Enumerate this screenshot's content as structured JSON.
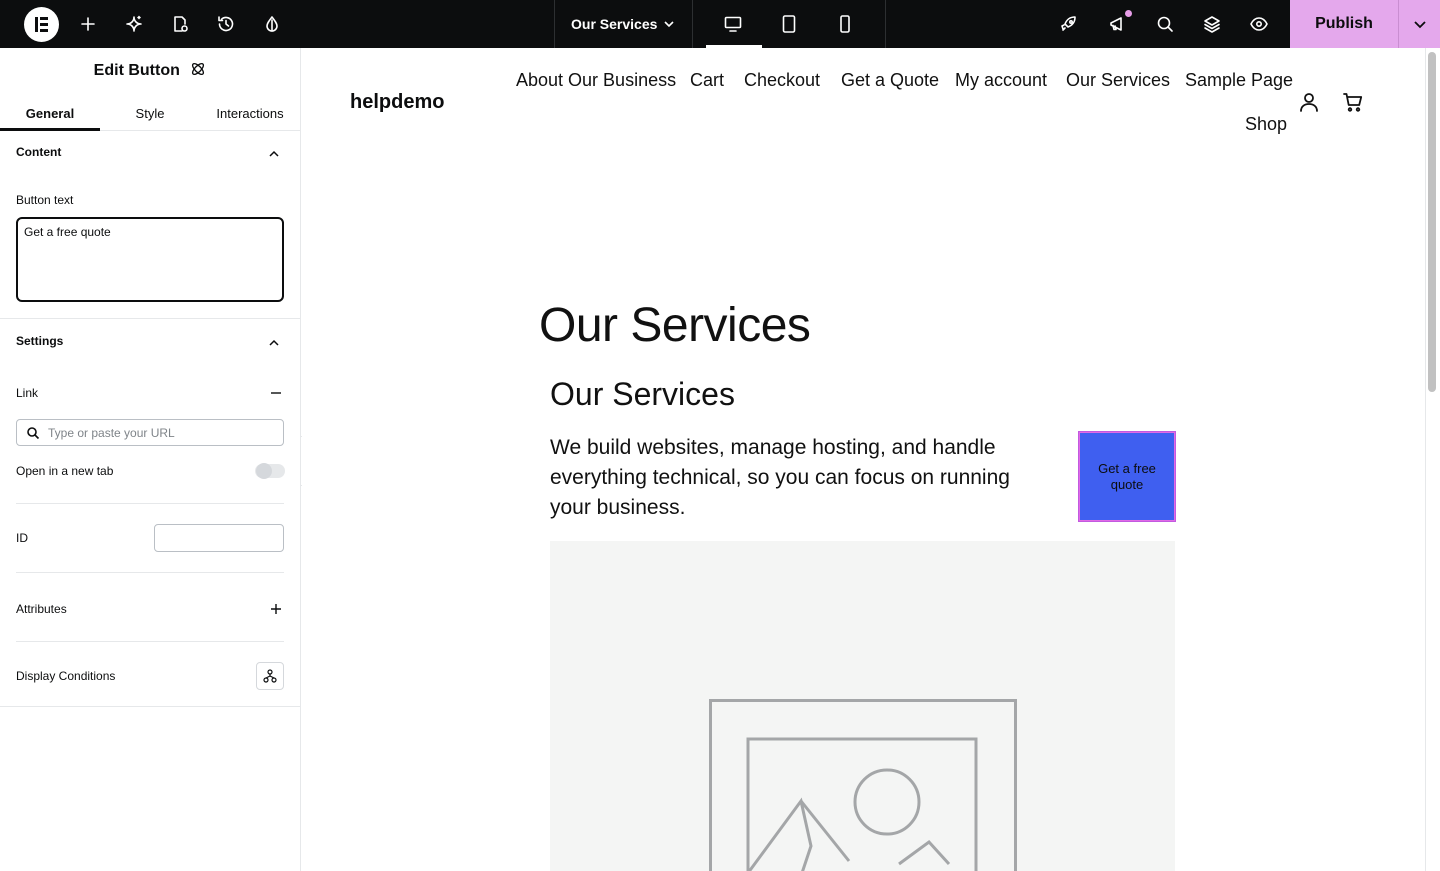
{
  "topbar": {
    "page_name": "Our Services",
    "publish_label": "Publish",
    "icons": [
      "elementor-logo",
      "plus-icon",
      "ai-sparkle-icon",
      "page-settings-icon",
      "history-icon",
      "theme-drop-icon",
      "chevron-down-icon",
      "desktop-icon",
      "tablet-icon",
      "mobile-icon",
      "rocket-icon",
      "megaphone-icon",
      "search-icon",
      "layers-icon",
      "eye-icon"
    ],
    "accent": "#e4a8ec"
  },
  "panel": {
    "title": "Edit Button",
    "tabs": [
      {
        "label": "General"
      },
      {
        "label": "Style"
      },
      {
        "label": "Interactions"
      }
    ],
    "content_section": "Content",
    "button_text_label": "Button text",
    "button_text_value": "Get a free quote",
    "settings_section": "Settings",
    "link_label": "Link",
    "url_placeholder": "Type or paste your URL",
    "new_tab_label": "Open in a new tab",
    "id_label": "ID",
    "attributes_label": "Attributes",
    "display_conditions_label": "Display Conditions"
  },
  "site": {
    "logo": "helpdemo",
    "nav": [
      {
        "label": "About Our Business"
      },
      {
        "label": "Cart"
      },
      {
        "label": "Checkout"
      },
      {
        "label": "Get a Quote"
      },
      {
        "label": "My account"
      },
      {
        "label": "Our Services"
      },
      {
        "label": "Sample Page"
      },
      {
        "label": "Shop"
      }
    ],
    "page_title": "Our Services",
    "section_heading": "Our Services",
    "section_text": "We build websites, manage hosting, and handle everything technical, so you can focus on running your business.",
    "cta_label": "Get a free quote",
    "cta_color": "#3f5ff0"
  }
}
